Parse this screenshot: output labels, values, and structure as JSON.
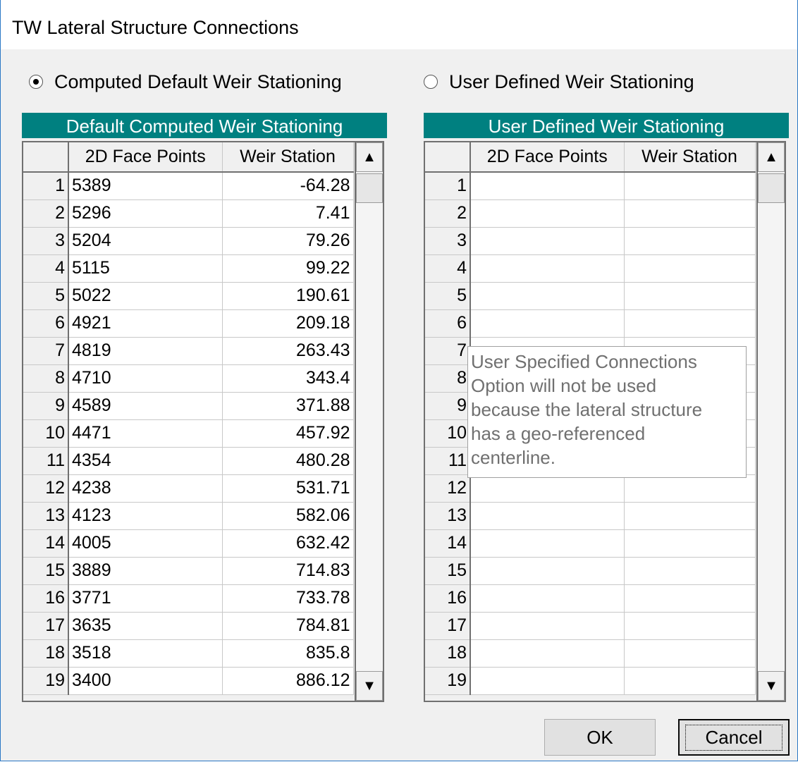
{
  "window": {
    "title": "TW Lateral Structure Connections"
  },
  "options": {
    "computed": {
      "label": "Computed Default Weir Stationing",
      "selected": true
    },
    "user": {
      "label": "User Defined Weir Stationing",
      "selected": false
    }
  },
  "left_panel": {
    "header": "Default Computed Weir Stationing",
    "columns": [
      "",
      "2D Face Points",
      "Weir Station"
    ],
    "rows": [
      {
        "n": "1",
        "face": "5389",
        "weir": "-64.28"
      },
      {
        "n": "2",
        "face": "5296",
        "weir": "7.41"
      },
      {
        "n": "3",
        "face": "5204",
        "weir": "79.26"
      },
      {
        "n": "4",
        "face": "5115",
        "weir": "99.22"
      },
      {
        "n": "5",
        "face": "5022",
        "weir": "190.61"
      },
      {
        "n": "6",
        "face": "4921",
        "weir": "209.18"
      },
      {
        "n": "7",
        "face": "4819",
        "weir": "263.43"
      },
      {
        "n": "8",
        "face": "4710",
        "weir": "343.4"
      },
      {
        "n": "9",
        "face": "4589",
        "weir": "371.88"
      },
      {
        "n": "10",
        "face": "4471",
        "weir": "457.92"
      },
      {
        "n": "11",
        "face": "4354",
        "weir": "480.28"
      },
      {
        "n": "12",
        "face": "4238",
        "weir": "531.71"
      },
      {
        "n": "13",
        "face": "4123",
        "weir": "582.06"
      },
      {
        "n": "14",
        "face": "4005",
        "weir": "632.42"
      },
      {
        "n": "15",
        "face": "3889",
        "weir": "714.83"
      },
      {
        "n": "16",
        "face": "3771",
        "weir": "733.78"
      },
      {
        "n": "17",
        "face": "3635",
        "weir": "784.81"
      },
      {
        "n": "18",
        "face": "3518",
        "weir": "835.8"
      },
      {
        "n": "19",
        "face": "3400",
        "weir": "886.12"
      }
    ]
  },
  "right_panel": {
    "header": "User Defined Weir Stationing",
    "columns": [
      "",
      "2D Face Points",
      "Weir Station"
    ],
    "rows": [
      {
        "n": "1",
        "face": "",
        "weir": ""
      },
      {
        "n": "2",
        "face": "",
        "weir": ""
      },
      {
        "n": "3",
        "face": "",
        "weir": ""
      },
      {
        "n": "4",
        "face": "",
        "weir": ""
      },
      {
        "n": "5",
        "face": "",
        "weir": ""
      },
      {
        "n": "6",
        "face": "",
        "weir": ""
      },
      {
        "n": "7",
        "face": "",
        "weir": ""
      },
      {
        "n": "8",
        "face": "",
        "weir": ""
      },
      {
        "n": "9",
        "face": "",
        "weir": ""
      },
      {
        "n": "10",
        "face": "",
        "weir": ""
      },
      {
        "n": "11",
        "face": "",
        "weir": ""
      },
      {
        "n": "12",
        "face": "",
        "weir": ""
      },
      {
        "n": "13",
        "face": "",
        "weir": ""
      },
      {
        "n": "14",
        "face": "",
        "weir": ""
      },
      {
        "n": "15",
        "face": "",
        "weir": ""
      },
      {
        "n": "16",
        "face": "",
        "weir": ""
      },
      {
        "n": "17",
        "face": "",
        "weir": ""
      },
      {
        "n": "18",
        "face": "",
        "weir": ""
      },
      {
        "n": "19",
        "face": "",
        "weir": ""
      }
    ]
  },
  "tooltip": "User Specified Connections\nOption will not be used\nbecause the lateral structure\nhas a geo-referenced\ncenterline.",
  "buttons": {
    "ok": "OK",
    "cancel": "Cancel"
  },
  "icons": {
    "scroll_up": "arrow-up-icon",
    "scroll_down": "arrow-down-icon"
  },
  "colors": {
    "header_bg": "#008080",
    "window_border": "#2b78c5"
  }
}
